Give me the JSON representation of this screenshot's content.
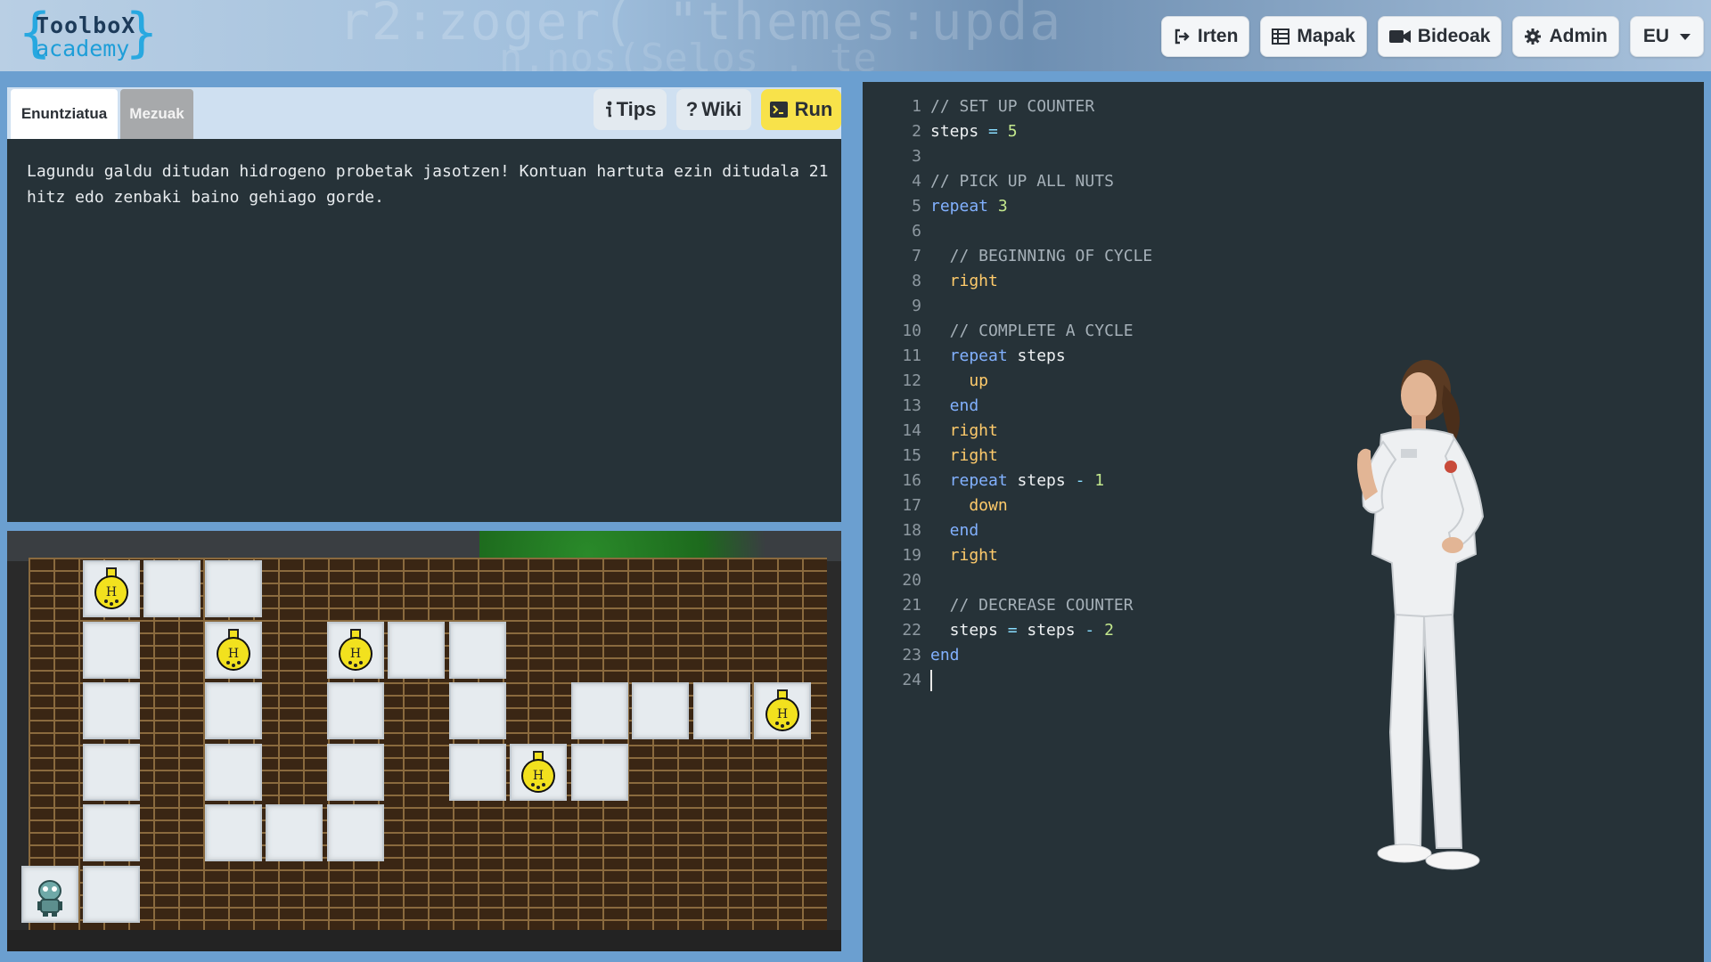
{
  "header": {
    "background_code_1": "r2:zoger(   \"themes:upda",
    "background_code_2": "n.nos(Selos .  te",
    "logo": {
      "line1": "ToolboX",
      "line2": "academy"
    },
    "nav": [
      {
        "label": "Irten",
        "icon": "sign-out-icon"
      },
      {
        "label": "Mapak",
        "icon": "table-icon"
      },
      {
        "label": "Bideoak",
        "icon": "video-camera-icon"
      },
      {
        "label": "Admin",
        "icon": "gear-icon"
      },
      {
        "label": "EU",
        "icon": "chevron-down-icon"
      }
    ]
  },
  "left_panel": {
    "tabs": [
      {
        "label": "Enuntziatua",
        "active": true
      },
      {
        "label": "Mezuak",
        "active": false
      }
    ],
    "buttons": {
      "tips": "Tips",
      "wiki": "Wiki",
      "run": "Run"
    },
    "statement": "Lagundu galdu ditudan hidrogeno probetak jasotzen! Kontuan hartuta ezin ditudala 21 hitz edo zenbaki baino gehiago gorde."
  },
  "game": {
    "flask_label": "H",
    "colors": {
      "tile": "#e6ebef",
      "brick": "#3a2614",
      "mortar": "#8a6a3e",
      "flask": "#f2e11e"
    }
  },
  "editor": {
    "lines": [
      {
        "n": "1",
        "tokens": [
          {
            "t": "// SET UP COUNTER",
            "c": "c-cmt"
          }
        ]
      },
      {
        "n": "2",
        "tokens": [
          {
            "t": "steps",
            "c": "c-var"
          },
          {
            "t": " = ",
            "c": "c-op"
          },
          {
            "t": "5",
            "c": "c-num"
          }
        ]
      },
      {
        "n": "3",
        "tokens": []
      },
      {
        "n": "4",
        "tokens": [
          {
            "t": "// PICK UP ALL NUTS",
            "c": "c-cmt"
          }
        ]
      },
      {
        "n": "5",
        "tokens": [
          {
            "t": "repeat",
            "c": "c-kw"
          },
          {
            "t": " ",
            "c": "c-var"
          },
          {
            "t": "3",
            "c": "c-num"
          }
        ]
      },
      {
        "n": "6",
        "tokens": []
      },
      {
        "n": "7",
        "tokens": [
          {
            "t": "  // BEGINNING OF CYCLE",
            "c": "c-cmt"
          }
        ]
      },
      {
        "n": "8",
        "tokens": [
          {
            "t": "  right",
            "c": "c-cmd"
          }
        ]
      },
      {
        "n": "9",
        "tokens": []
      },
      {
        "n": "10",
        "tokens": [
          {
            "t": "  // COMPLETE A CYCLE",
            "c": "c-cmt"
          }
        ]
      },
      {
        "n": "11",
        "tokens": [
          {
            "t": "  repeat",
            "c": "c-kw"
          },
          {
            "t": " steps",
            "c": "c-var"
          }
        ]
      },
      {
        "n": "12",
        "tokens": [
          {
            "t": "    up",
            "c": "c-cmd"
          }
        ]
      },
      {
        "n": "13",
        "tokens": [
          {
            "t": "  end",
            "c": "c-kw"
          }
        ]
      },
      {
        "n": "14",
        "tokens": [
          {
            "t": "  right",
            "c": "c-cmd"
          }
        ]
      },
      {
        "n": "15",
        "tokens": [
          {
            "t": "  right",
            "c": "c-cmd"
          }
        ]
      },
      {
        "n": "16",
        "tokens": [
          {
            "t": "  repeat",
            "c": "c-kw"
          },
          {
            "t": " steps",
            "c": "c-var"
          },
          {
            "t": " - ",
            "c": "c-op"
          },
          {
            "t": "1",
            "c": "c-num"
          }
        ]
      },
      {
        "n": "17",
        "tokens": [
          {
            "t": "    down",
            "c": "c-cmd"
          }
        ]
      },
      {
        "n": "18",
        "tokens": [
          {
            "t": "  end",
            "c": "c-kw"
          }
        ]
      },
      {
        "n": "19",
        "tokens": [
          {
            "t": "  right",
            "c": "c-cmd"
          }
        ]
      },
      {
        "n": "20",
        "tokens": []
      },
      {
        "n": "21",
        "tokens": [
          {
            "t": "  // DECREASE COUNTER",
            "c": "c-cmt"
          }
        ]
      },
      {
        "n": "22",
        "tokens": [
          {
            "t": "  steps",
            "c": "c-var"
          },
          {
            "t": " = ",
            "c": "c-op"
          },
          {
            "t": "steps",
            "c": "c-var"
          },
          {
            "t": " - ",
            "c": "c-op"
          },
          {
            "t": "2",
            "c": "c-num"
          }
        ]
      },
      {
        "n": "23",
        "tokens": [
          {
            "t": "end",
            "c": "c-kw"
          }
        ]
      },
      {
        "n": "24",
        "tokens": []
      }
    ]
  }
}
